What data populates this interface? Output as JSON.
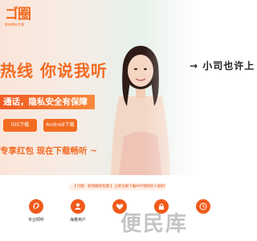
{
  "logo": {
    "mark": "ゴ圈",
    "subtitle": "即刻拥有专属"
  },
  "banner": {
    "headline": "热线  你说我听",
    "subline": "通话，隐私安全有保障",
    "ios_button": "IOS下载",
    "android_button": "Android下载",
    "tagline": "专享红包  现在下载畅听  ~"
  },
  "side_text": "→ 小司也许上",
  "notice": "【 付圈 · 职场解忧指南 】立即注册下载APP领取新人福利！",
  "features": [
    {
      "label": "专业倾听",
      "icon": "ear-icon"
    },
    {
      "label": "海量用户",
      "icon": "users-icon"
    },
    {
      "label": "",
      "icon": "heart-icon"
    },
    {
      "label": "",
      "icon": "lock-icon"
    },
    {
      "label": "",
      "icon": "clock-icon"
    }
  ],
  "watermark": "便民库",
  "colors": {
    "accent": "#f26b21",
    "accent_dark": "#f05a1a"
  }
}
